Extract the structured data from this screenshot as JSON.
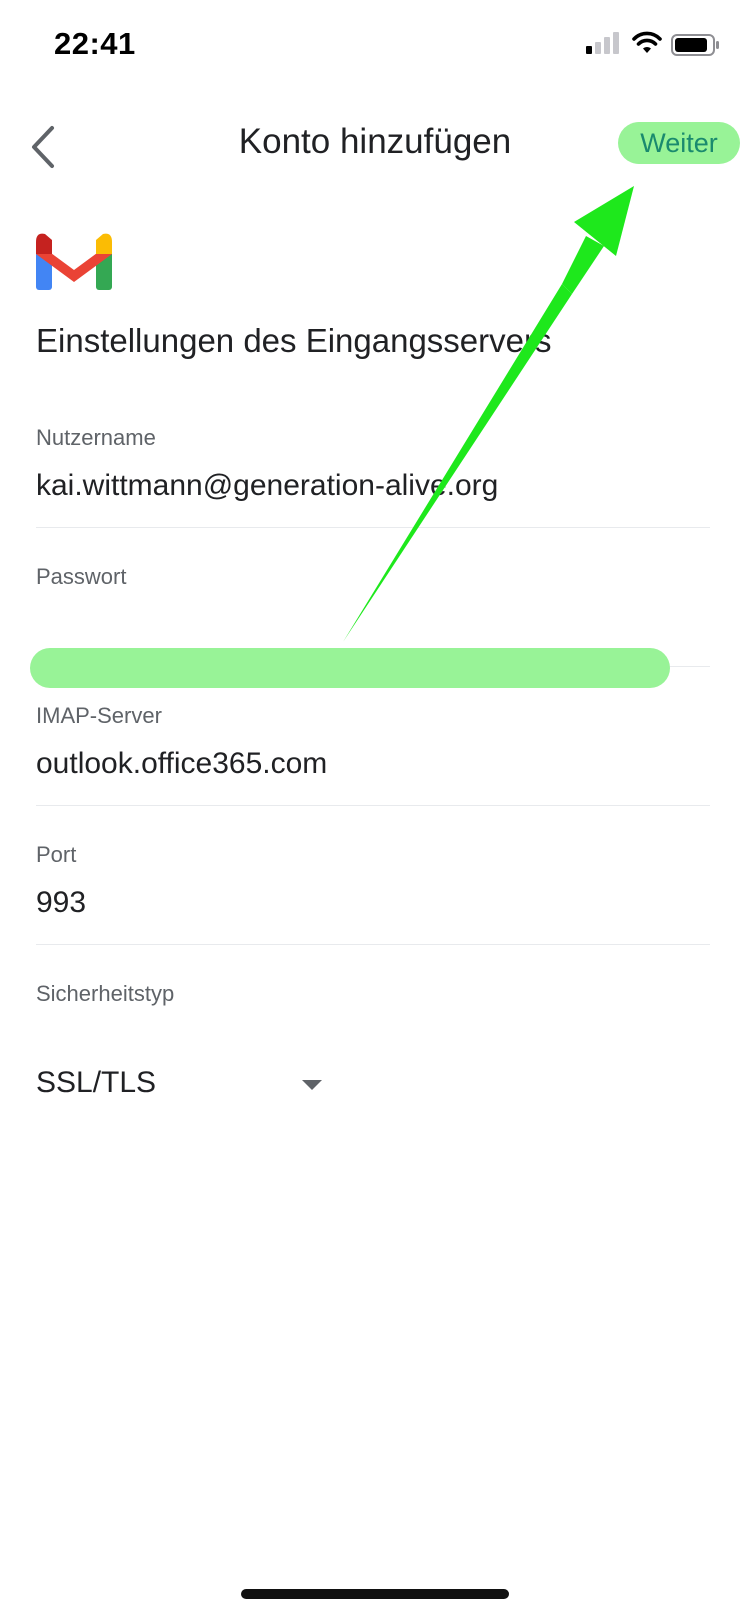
{
  "status_bar": {
    "time": "22:41"
  },
  "app_bar": {
    "title": "Konto hinzufügen",
    "next_label": "Weiter"
  },
  "heading": "Einstellungen des Eingangsservers",
  "fields": {
    "username": {
      "label": "Nutzername",
      "value": "kai.wittmann@generation-alive.org"
    },
    "password": {
      "label": "Passwort"
    },
    "imap_server": {
      "label": "IMAP-Server",
      "value": "outlook.office365.com"
    },
    "port": {
      "label": "Port",
      "value": "993"
    },
    "security_type": {
      "label": "Sicherheitstyp",
      "value": "SSL/TLS"
    }
  },
  "colors": {
    "highlight": "#98f397",
    "arrow": "#1ee81c",
    "next_text": "#1a8a6e"
  }
}
